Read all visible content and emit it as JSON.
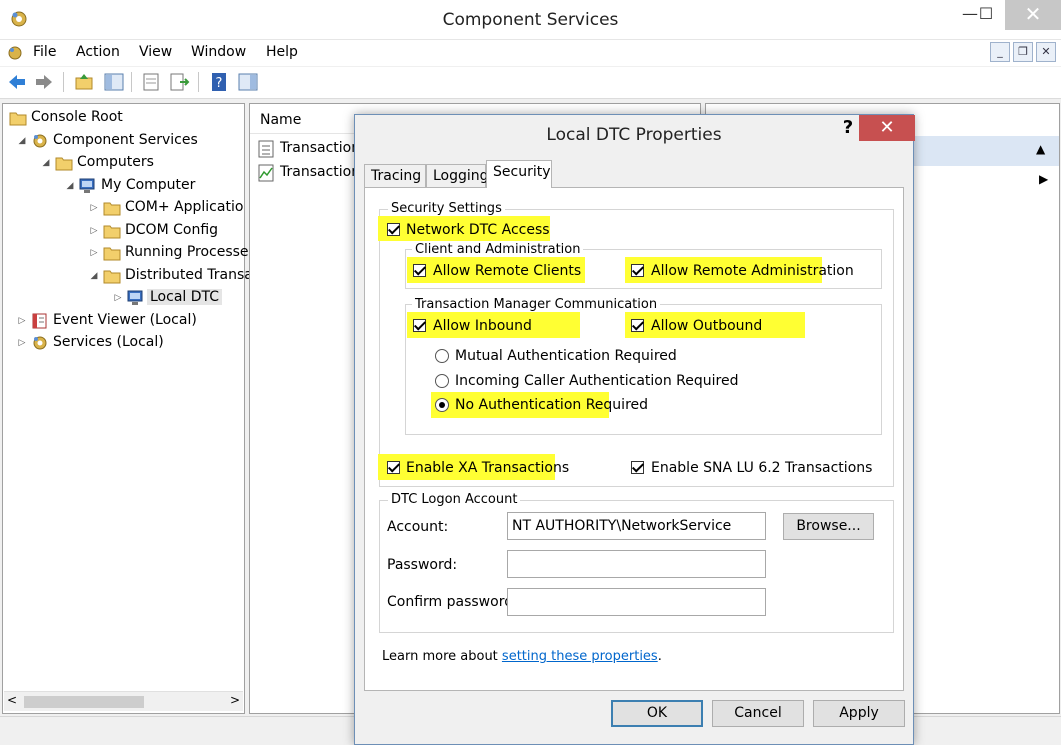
{
  "window": {
    "title": "Component Services"
  },
  "window_controls": {
    "minimize": "—",
    "maximize": "☐",
    "close": "✕"
  },
  "menu": [
    "File",
    "Action",
    "View",
    "Window",
    "Help"
  ],
  "mdi_controls": [
    "_",
    "❐",
    "✕"
  ],
  "tree": [
    {
      "label": "Console Root",
      "depth": 0,
      "expander": "",
      "icon": "folder"
    },
    {
      "label": "Component Services",
      "depth": 1,
      "expander": "◢",
      "icon": "gear"
    },
    {
      "label": "Computers",
      "depth": 2,
      "expander": "◢",
      "icon": "folder"
    },
    {
      "label": "My Computer",
      "depth": 3,
      "expander": "◢",
      "icon": "computer"
    },
    {
      "label": "COM+ Applicatio",
      "depth": 4,
      "expander": "▷",
      "icon": "folder"
    },
    {
      "label": "DCOM Config",
      "depth": 4,
      "expander": "▷",
      "icon": "folder"
    },
    {
      "label": "Running Processe",
      "depth": 4,
      "expander": "▷",
      "icon": "folder"
    },
    {
      "label": "Distributed Transa",
      "depth": 4,
      "expander": "◢",
      "icon": "folder"
    },
    {
      "label": "Local DTC",
      "depth": 5,
      "expander": "▷",
      "icon": "computer",
      "selected": true
    },
    {
      "label": "Event Viewer (Local)",
      "depth": 1,
      "expander": "▷",
      "icon": "eventlog"
    },
    {
      "label": "Services (Local)",
      "depth": 1,
      "expander": "▷",
      "icon": "gear"
    }
  ],
  "tree_scroll": {
    "left": "<",
    "right": ">"
  },
  "list": {
    "column": "Name",
    "items": [
      "Transaction",
      "Transaction"
    ]
  },
  "actions": {
    "up": "▲",
    "more": "▶"
  },
  "dialog": {
    "title": "Local DTC Properties",
    "help": "?",
    "close": "✕",
    "tabs": [
      "Tracing",
      "Logging",
      "Security"
    ],
    "active_tab": "Security",
    "security_settings_label": "Security Settings",
    "network_dtc_access": "Network DTC Access",
    "client_admin_label": "Client and Administration",
    "allow_remote_clients": "Allow Remote Clients",
    "allow_remote_admin": "Allow Remote Administration",
    "tm_comm_label": "Transaction Manager Communication",
    "allow_inbound": "Allow Inbound",
    "allow_outbound": "Allow Outbound",
    "auth_options": [
      {
        "label": "Mutual Authentication Required",
        "selected": false
      },
      {
        "label": "Incoming Caller Authentication Required",
        "selected": false
      },
      {
        "label": "No Authentication Required",
        "selected": true
      }
    ],
    "enable_xa": "Enable XA Transactions",
    "enable_sna": "Enable SNA LU 6.2 Transactions",
    "logon_label": "DTC Logon Account",
    "account_label": "Account:",
    "account_value": "NT AUTHORITY\\NetworkService",
    "browse": "Browse...",
    "password_label": "Password:",
    "password_value": "",
    "confirm_label": "Confirm password:",
    "confirm_value": "",
    "learn_more": "Learn more about",
    "learn_more_link": "setting these properties",
    "learn_more_end": ".",
    "ok": "OK",
    "cancel": "Cancel",
    "apply": "Apply"
  },
  "colors": {
    "highlight": "#ffff33",
    "link": "#0066cc",
    "close_red": "#c75050"
  }
}
